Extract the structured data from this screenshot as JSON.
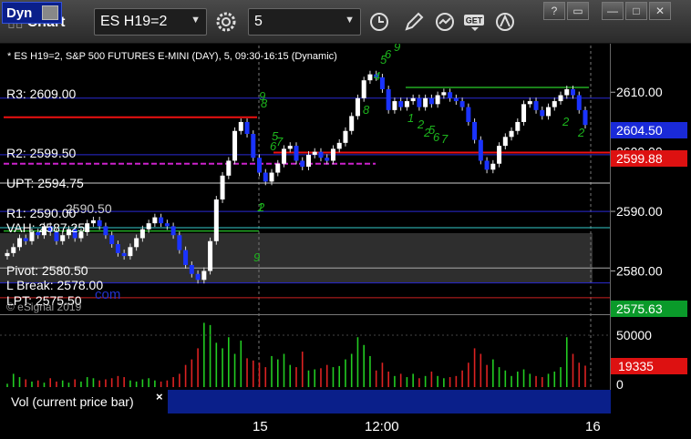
{
  "window": {
    "title": "Chart",
    "symbol": "ES H19=2",
    "interval": "5",
    "buttons": [
      "help-button",
      "restore-button",
      "minimize-button",
      "maximize-button",
      "close-button"
    ]
  },
  "chart": {
    "header": "* ES H19=2, S&P 500 FUTURES E-MINI (DAY), 5, 09:30-16:15 (Dynamic)",
    "watermark": "© eSignal 2019",
    "levels": [
      {
        "label": "R3: 2609.00",
        "value": 2609.0,
        "color": "#2b2bd4"
      },
      {
        "label": "R2: 2599.50",
        "value": 2599.5,
        "color": "#2b2bd4"
      },
      {
        "label": "UPT: 2594.75",
        "value": 2594.75,
        "color": "#cccccc"
      },
      {
        "label": "R1: 2590.00",
        "value": 2590.0,
        "color": "#2b2bd4"
      },
      {
        "label": "VAH: 2587.25",
        "value": 2587.25,
        "color": "#33cccc"
      },
      {
        "label": "Pivot: 2580.50",
        "value": 2580.5,
        "color": "#aaaaaa"
      },
      {
        "label": "L Break: 2578.00",
        "value": 2578.0,
        "color": "#2b2bd4"
      },
      {
        "label": "LPT: 2575.50",
        "value": 2575.5,
        "color": "#cc2222"
      }
    ],
    "overlapped_text": "2590.50",
    "overlapped_url_text": "com",
    "price_axis": {
      "ticks": [
        "2610.00",
        "2600.00",
        "2590.00",
        "2580.00"
      ],
      "tick_values": [
        2610,
        2600,
        2590,
        2580
      ],
      "last_price": "2604.50",
      "red_price": "2599.88",
      "green_price": "2575.63"
    },
    "time_axis": {
      "ticks": [
        "15",
        "12:00",
        "16"
      ]
    },
    "setup_counts": [
      "9",
      "8",
      "5",
      "6",
      "7",
      "2",
      "4",
      "5",
      "6",
      "9",
      "8",
      "1",
      "2",
      "2",
      "5",
      "6",
      "7",
      "9",
      "1",
      "2",
      "2"
    ],
    "volume": {
      "panel_label": "Vol (current price bar)",
      "axis_ticks": [
        "50000",
        "0"
      ],
      "current": "19335"
    },
    "bottom": {
      "button": "Dyn"
    }
  },
  "chart_data": {
    "type": "line",
    "title": "* ES H19=2, S&P 500 FUTURES E-MINI (DAY), 5, 09:30-16:15 (Dynamic)",
    "xlabel": "",
    "ylabel": "",
    "ylim": [
      2573.5,
      2616
    ],
    "series": [
      {
        "values": [
          2583.0,
          2584.0,
          2585.5,
          2585.0,
          2586.5,
          2586.0,
          2587.5,
          2586.5,
          2585.0,
          2586.0,
          2587.0,
          2585.5,
          2586.5,
          2588.0,
          2588.5,
          2587.5,
          2586.0,
          2584.5,
          2583.0,
          2582.5,
          2584.0,
          2585.5,
          2587.0,
          2588.0,
          2589.0,
          2588.0,
          2587.5,
          2586.0,
          2583.5,
          2581.0,
          2579.5,
          2578.5,
          2580.0,
          2585.0,
          2592.0,
          2596.0,
          2598.5,
          2603.5,
          2605.0,
          2603.0,
          2599.0,
          2596.5,
          2595.0,
          2596.5,
          2598.0,
          2600.5,
          2601.0,
          2598.5,
          2597.5,
          2599.5,
          2600.0,
          2599.0,
          2598.5,
          2600.5,
          2601.5,
          2603.5,
          2606.0,
          2609.0,
          2612.0,
          2613.0,
          2612.5,
          2610.5,
          2607.0,
          2608.5,
          2607.5,
          2608.5,
          2609.0,
          2607.5,
          2609.0,
          2608.0,
          2609.5,
          2610.0,
          2609.0,
          2608.5,
          2607.5,
          2605.0,
          2602.0,
          2598.5,
          2597.0,
          2598.0,
          2601.0,
          2602.5,
          2603.5,
          2605.0,
          2608.0,
          2608.5,
          2607.0,
          2606.0,
          2607.5,
          2608.5,
          2609.5,
          2610.5,
          2609.5,
          2607.0,
          2604.5
        ]
      }
    ],
    "volume": [
      3000,
      12000,
      9000,
      7000,
      5000,
      6000,
      4000,
      8000,
      5000,
      6000,
      4000,
      7000,
      5000,
      9000,
      8000,
      6000,
      7000,
      8000,
      10000,
      9000,
      6000,
      5000,
      7000,
      8000,
      6000,
      5000,
      6000,
      9000,
      12000,
      20000,
      25000,
      35000,
      58000,
      56000,
      40000,
      35000,
      45000,
      30000,
      42000,
      26000,
      24000,
      22000,
      18000,
      28000,
      25000,
      30000,
      20000,
      18000,
      32000,
      15000,
      16000,
      17000,
      20000,
      18000,
      19000,
      25000,
      30000,
      45000,
      38000,
      28000,
      15000,
      22000,
      14000,
      10000,
      12000,
      9000,
      12000,
      8000,
      10000,
      14000,
      10000,
      8000,
      9000,
      10000,
      15000,
      22000,
      35000,
      30000,
      20000,
      25000,
      18000,
      15000,
      10000,
      14000,
      16000,
      12000,
      10000,
      9000,
      12000,
      14000,
      18000,
      45000,
      30000,
      22000,
      19335
    ]
  }
}
